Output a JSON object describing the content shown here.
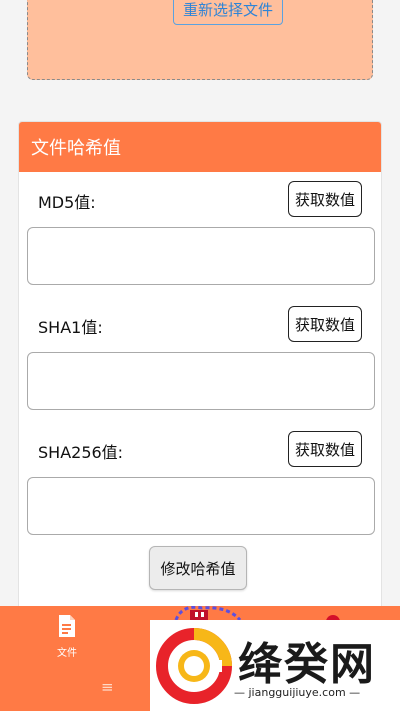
{
  "upload": {
    "reselect_label": "重新选择文件"
  },
  "hash_panel": {
    "title": "文件哈希值",
    "get_value_label": "获取数值",
    "modify_label": "修改哈希值",
    "md5": {
      "label": "MD5值:",
      "value": ""
    },
    "sha1": {
      "label": "SHA1值:",
      "value": ""
    },
    "sha256": {
      "label": "SHA256值:",
      "value": ""
    }
  },
  "bottom_nav": {
    "file_label": "文件",
    "menu_glyph": "≡"
  },
  "watermark": {
    "brand": "绛癸网",
    "url": "— jiangguijiuye.com —"
  },
  "colors": {
    "accent": "#ff7a45",
    "drop_zone": "#ffbf9c",
    "reselect_text": "#2f84d6"
  }
}
